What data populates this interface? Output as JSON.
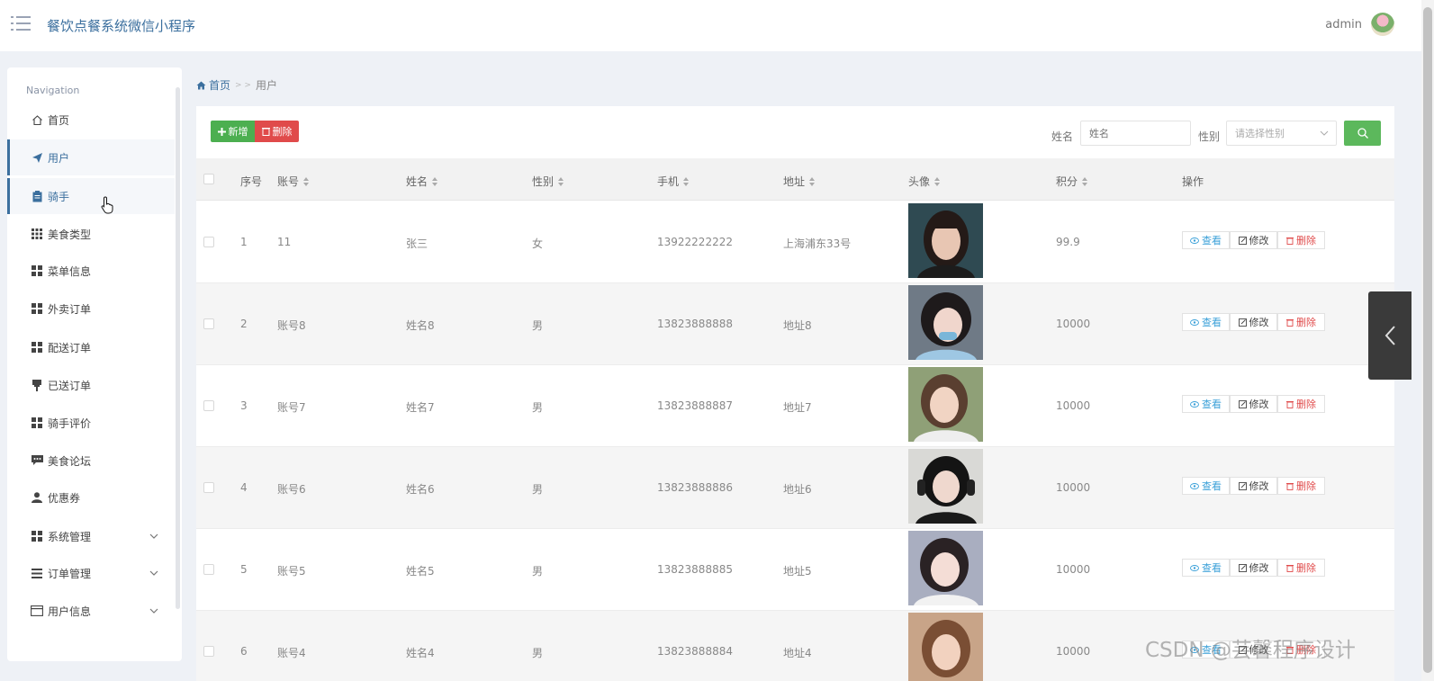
{
  "header": {
    "app_title": "餐饮点餐系统微信小程序",
    "user_name": "admin"
  },
  "sidebar": {
    "heading": "Navigation",
    "items": [
      {
        "label": "首页",
        "icon": "home-icon"
      },
      {
        "label": "用户",
        "icon": "send-icon"
      },
      {
        "label": "骑手",
        "icon": "clipboard-icon"
      },
      {
        "label": "美食类型",
        "icon": "grid-icon"
      },
      {
        "label": "菜单信息",
        "icon": "grid-icon"
      },
      {
        "label": "外卖订单",
        "icon": "grid-icon"
      },
      {
        "label": "配送订单",
        "icon": "grid-icon"
      },
      {
        "label": "已送订单",
        "icon": "pushpin-icon"
      },
      {
        "label": "骑手评价",
        "icon": "grid-icon"
      },
      {
        "label": "美食论坛",
        "icon": "comment-icon"
      },
      {
        "label": "优惠券",
        "icon": "user-icon"
      },
      {
        "label": "系统管理",
        "icon": "grid-icon"
      },
      {
        "label": "订单管理",
        "icon": "list-icon"
      },
      {
        "label": "用户信息",
        "icon": "card-icon"
      }
    ]
  },
  "breadcrumb": {
    "home": "首页",
    "separator": "> >",
    "current": "用户"
  },
  "toolbar": {
    "add_label": "新增",
    "delete_label": "删除",
    "name_label": "姓名",
    "name_placeholder": "姓名",
    "gender_label": "性别",
    "gender_placeholder": "请选择性别"
  },
  "table": {
    "columns": [
      "序号",
      "账号",
      "姓名",
      "性别",
      "手机",
      "地址",
      "头像",
      "积分",
      "操作"
    ],
    "rows": [
      {
        "index": "1",
        "account": "11",
        "name": "张三",
        "gender": "女",
        "phone": "13922222222",
        "address": "上海浦东33号",
        "points": "99.9"
      },
      {
        "index": "2",
        "account": "账号8",
        "name": "姓名8",
        "gender": "男",
        "phone": "13823888888",
        "address": "地址8",
        "points": "10000"
      },
      {
        "index": "3",
        "account": "账号7",
        "name": "姓名7",
        "gender": "男",
        "phone": "13823888887",
        "address": "地址7",
        "points": "10000"
      },
      {
        "index": "4",
        "account": "账号6",
        "name": "姓名6",
        "gender": "男",
        "phone": "13823888886",
        "address": "地址6",
        "points": "10000"
      },
      {
        "index": "5",
        "account": "账号5",
        "name": "姓名5",
        "gender": "男",
        "phone": "13823888885",
        "address": "地址5",
        "points": "10000"
      },
      {
        "index": "6",
        "account": "账号4",
        "name": "姓名4",
        "gender": "男",
        "phone": "13823888884",
        "address": "地址4",
        "points": "10000"
      }
    ],
    "actions": {
      "view": "查看",
      "edit": "修改",
      "delete": "删除"
    }
  },
  "watermark": "CSDN @芸馨程序设计",
  "colors": {
    "brand": "#3b6f9e",
    "add": "#4caf50",
    "danger": "#e04b4b",
    "search": "#5cb85c",
    "view": "#3aa0d8"
  }
}
